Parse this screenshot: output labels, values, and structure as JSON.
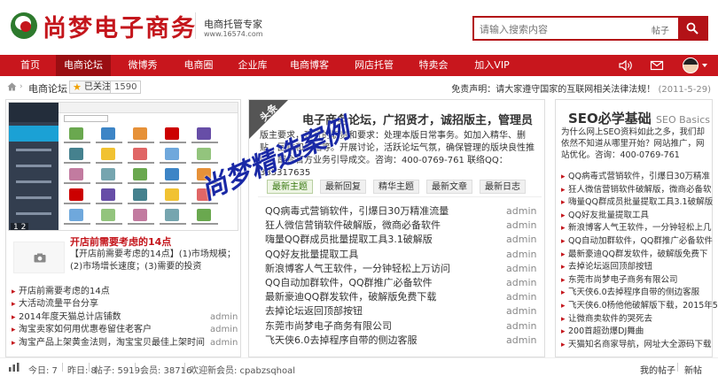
{
  "brand": {
    "logo_text": "尚梦电子商务",
    "tagline": "电商托管专家",
    "url": "www.16574.com"
  },
  "search": {
    "placeholder": "请输入搜索内容",
    "scope": "帖子"
  },
  "nav": {
    "items": [
      "首页",
      "电商论坛",
      "微博秀",
      "电商圈",
      "企业库",
      "电商博客",
      "网店托管",
      "特卖会",
      "加入VIP"
    ],
    "active": "电商论坛",
    "icons": [
      "volume-icon",
      "mail-icon",
      "user-avatar"
    ]
  },
  "breadcrumb": {
    "forum": "电商论坛",
    "follow": "已关注",
    "follow_count": "1590"
  },
  "notice": {
    "text": "免责声明：请大家遵守国家的互联网相关法律法规！",
    "date": "(2011-5-29)"
  },
  "featured": {
    "pager": "1 2",
    "title": "开店前需要考虑的14点",
    "desc": "【开店前需要考虑的14点】(1)市场规模；(2)市场增长速度；(3)需要的投资"
  },
  "left_list": [
    {
      "title": "开店前需要考虑的14点",
      "author": ""
    },
    {
      "title": "大活动流量平台分享",
      "author": ""
    },
    {
      "title": "2014年度天猫总计店铺数",
      "author": "admin"
    },
    {
      "title": "淘宝卖家如何用优惠卷留住老客户",
      "author": "admin"
    },
    {
      "title": "淘宝产品上架黄金法则，淘宝宝贝最佳上架时间",
      "author": "admin"
    }
  ],
  "mid": {
    "ribbon": "头条",
    "title": "电子商务论坛，广招贤才，诚招版主，管理员",
    "desc": "版主要求，现行的职责和要求：处理本版日常事务。如加入精华、删贴、回贴和发贴等。开展讨论，活跃论坛气氛，确保管理的版块良性推广，配合官方业务引导成交。咨询：400-0769-761 联络QQ：385317635",
    "tabs": [
      "最新主题",
      "最新回复",
      "精华主题",
      "最新文章",
      "最新日志"
    ],
    "active_tab": "最新主题",
    "list": [
      {
        "title": "QQ病毒式营销软件，引爆日30万精准流量",
        "author": "admin"
      },
      {
        "title": "狂人微信营销软件破解版，微商必备软件",
        "author": "admin"
      },
      {
        "title": "嗨量QQ群成员批量提取工具3.1破解版",
        "author": "admin"
      },
      {
        "title": "QQ好友批量提取工具",
        "author": "admin"
      },
      {
        "title": "新浪博客人气王软件，一分钟轻松上万访问",
        "author": "admin"
      },
      {
        "title": "QQ自动加群软件，QQ群推广必备软件",
        "author": "admin"
      },
      {
        "title": "最新豪迪QQ群发软件，破解版免费下载",
        "author": "admin"
      },
      {
        "title": "去掉论坛返回顶部按钮",
        "author": "admin"
      },
      {
        "title": "东莞市尚梦电子商务有限公司",
        "author": "admin"
      },
      {
        "title": "飞天侠6.0去掉程序自带的侧边客服",
        "author": "admin"
      }
    ],
    "watermark": "尚梦精选案例"
  },
  "right": {
    "title": "SEO必学基础",
    "title_en": "SEO Basics",
    "desc": "为什么网上SEO资料如此之多，我们却依然不知道从哪里开始？网站推广，网站优化。咨询：400-0769-761",
    "list": [
      "QQ病毒式营销软件，引爆日30万精准",
      "狂人微信营销软件破解版，微商必备软",
      "嗨量QQ群成员批量提取工具3.1破解版",
      "QQ好友批量提取工具",
      "新浪博客人气王软件，一分钟轻松上几",
      "QQ自动加群软件，QQ群推广必备软件",
      "最新豪迪QQ群发软件，破解版免费下",
      "去掉论坛返回顶部按钮",
      "东莞市尚梦电子商务有限公司",
      "飞天侠6.0去掉程序自带的侧边客服",
      "飞天侠6.0杨他他破解版下载，2015年5",
      "让微商卖软件的哭死去",
      "200首超劲爆DJ舞曲",
      "天猫知名商家导航，网址大全源码下载"
    ]
  },
  "stats": {
    "today": "今日: 7",
    "yesterday": "昨日: 8",
    "posts": "帖子: 5919",
    "members": "会员: 38716",
    "newest": "欢迎新会员: cpabzsqhoal",
    "my_posts": "我的帖子",
    "new_posts": "新帖"
  },
  "colors": {
    "brand_red": "#c8161d",
    "active_nav": "#9a0e12",
    "link_green": "#3a7a12",
    "watermark_blue": "#1a29a6"
  }
}
